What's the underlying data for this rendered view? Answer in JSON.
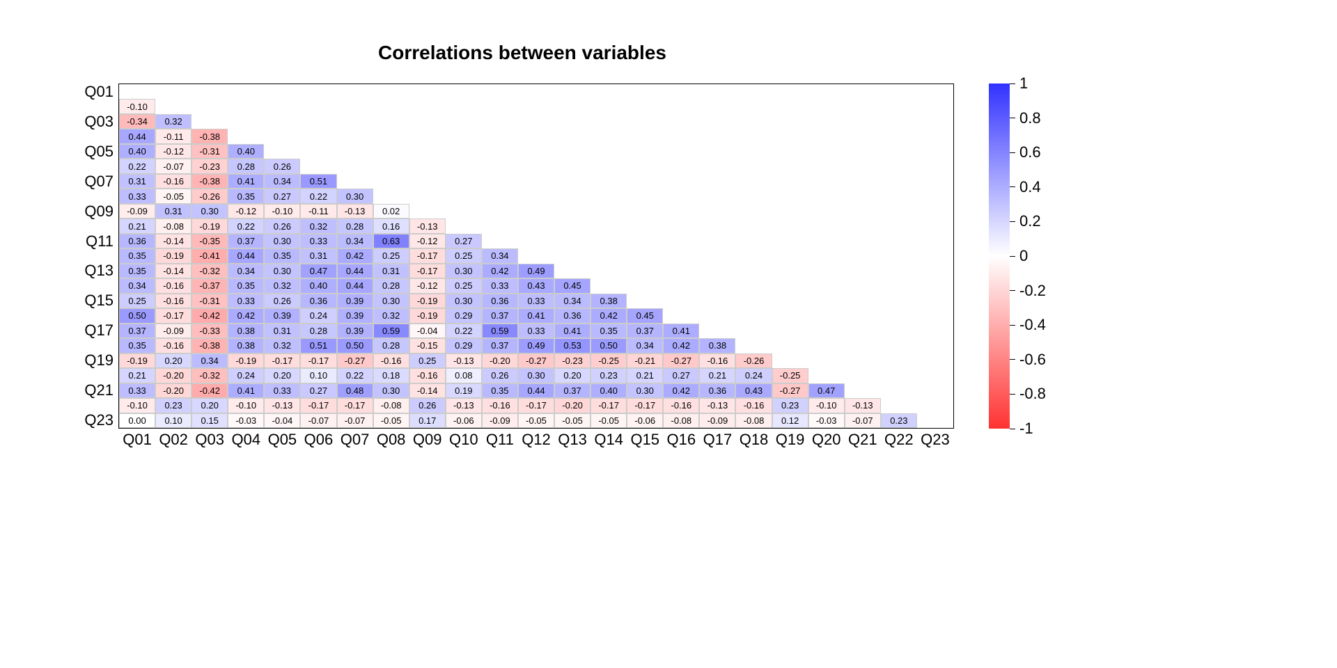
{
  "chart_data": {
    "type": "heatmap",
    "title": "Correlations between variables",
    "variables": [
      "Q01",
      "Q02",
      "Q03",
      "Q04",
      "Q05",
      "Q06",
      "Q07",
      "Q08",
      "Q09",
      "Q10",
      "Q11",
      "Q12",
      "Q13",
      "Q14",
      "Q15",
      "Q16",
      "Q17",
      "Q18",
      "Q19",
      "Q20",
      "Q21",
      "Q22",
      "Q23"
    ],
    "ylabels_shown": [
      "Q01",
      "Q03",
      "Q05",
      "Q07",
      "Q09",
      "Q11",
      "Q13",
      "Q15",
      "Q17",
      "Q19",
      "Q21",
      "Q23"
    ],
    "colorbar": {
      "min": -1,
      "max": 1,
      "ticks": [
        1,
        0.8,
        0.6,
        0.4,
        0.2,
        0,
        -0.2,
        -0.4,
        -0.6,
        -0.8,
        -1
      ],
      "colors": {
        "neg": "#ff0000",
        "zero": "#ffffff",
        "pos": "#0000ff"
      }
    },
    "matrix": [
      [
        null,
        null,
        null,
        null,
        null,
        null,
        null,
        null,
        null,
        null,
        null,
        null,
        null,
        null,
        null,
        null,
        null,
        null,
        null,
        null,
        null,
        null,
        null
      ],
      [
        -0.1,
        null,
        null,
        null,
        null,
        null,
        null,
        null,
        null,
        null,
        null,
        null,
        null,
        null,
        null,
        null,
        null,
        null,
        null,
        null,
        null,
        null,
        null
      ],
      [
        -0.34,
        0.32,
        null,
        null,
        null,
        null,
        null,
        null,
        null,
        null,
        null,
        null,
        null,
        null,
        null,
        null,
        null,
        null,
        null,
        null,
        null,
        null,
        null
      ],
      [
        0.44,
        -0.11,
        -0.38,
        null,
        null,
        null,
        null,
        null,
        null,
        null,
        null,
        null,
        null,
        null,
        null,
        null,
        null,
        null,
        null,
        null,
        null,
        null,
        null
      ],
      [
        0.4,
        -0.12,
        -0.31,
        0.4,
        null,
        null,
        null,
        null,
        null,
        null,
        null,
        null,
        null,
        null,
        null,
        null,
        null,
        null,
        null,
        null,
        null,
        null,
        null
      ],
      [
        0.22,
        -0.07,
        -0.23,
        0.28,
        0.26,
        null,
        null,
        null,
        null,
        null,
        null,
        null,
        null,
        null,
        null,
        null,
        null,
        null,
        null,
        null,
        null,
        null,
        null
      ],
      [
        0.31,
        -0.16,
        -0.38,
        0.41,
        0.34,
        0.51,
        null,
        null,
        null,
        null,
        null,
        null,
        null,
        null,
        null,
        null,
        null,
        null,
        null,
        null,
        null,
        null,
        null
      ],
      [
        0.33,
        -0.05,
        -0.26,
        0.35,
        0.27,
        0.22,
        0.3,
        null,
        null,
        null,
        null,
        null,
        null,
        null,
        null,
        null,
        null,
        null,
        null,
        null,
        null,
        null,
        null
      ],
      [
        -0.09,
        0.31,
        0.3,
        -0.12,
        -0.1,
        -0.11,
        -0.13,
        0.02,
        null,
        null,
        null,
        null,
        null,
        null,
        null,
        null,
        null,
        null,
        null,
        null,
        null,
        null,
        null
      ],
      [
        0.21,
        -0.08,
        -0.19,
        0.22,
        0.26,
        0.32,
        0.28,
        0.16,
        -0.13,
        null,
        null,
        null,
        null,
        null,
        null,
        null,
        null,
        null,
        null,
        null,
        null,
        null,
        null
      ],
      [
        0.36,
        -0.14,
        -0.35,
        0.37,
        0.3,
        0.33,
        0.34,
        0.63,
        -0.12,
        0.27,
        null,
        null,
        null,
        null,
        null,
        null,
        null,
        null,
        null,
        null,
        null,
        null,
        null
      ],
      [
        0.35,
        -0.19,
        -0.41,
        0.44,
        0.35,
        0.31,
        0.42,
        0.25,
        -0.17,
        0.25,
        0.34,
        null,
        null,
        null,
        null,
        null,
        null,
        null,
        null,
        null,
        null,
        null,
        null
      ],
      [
        0.35,
        -0.14,
        -0.32,
        0.34,
        0.3,
        0.47,
        0.44,
        0.31,
        -0.17,
        0.3,
        0.42,
        0.49,
        null,
        null,
        null,
        null,
        null,
        null,
        null,
        null,
        null,
        null,
        null
      ],
      [
        0.34,
        -0.16,
        -0.37,
        0.35,
        0.32,
        0.4,
        0.44,
        0.28,
        -0.12,
        0.25,
        0.33,
        0.43,
        0.45,
        null,
        null,
        null,
        null,
        null,
        null,
        null,
        null,
        null,
        null
      ],
      [
        0.25,
        -0.16,
        -0.31,
        0.33,
        0.26,
        0.36,
        0.39,
        0.3,
        -0.19,
        0.3,
        0.36,
        0.33,
        0.34,
        0.38,
        null,
        null,
        null,
        null,
        null,
        null,
        null,
        null,
        null
      ],
      [
        0.5,
        -0.17,
        -0.42,
        0.42,
        0.39,
        0.24,
        0.39,
        0.32,
        -0.19,
        0.29,
        0.37,
        0.41,
        0.36,
        0.42,
        0.45,
        null,
        null,
        null,
        null,
        null,
        null,
        null,
        null
      ],
      [
        0.37,
        -0.09,
        -0.33,
        0.38,
        0.31,
        0.28,
        0.39,
        0.59,
        -0.04,
        0.22,
        0.59,
        0.33,
        0.41,
        0.35,
        0.37,
        0.41,
        null,
        null,
        null,
        null,
        null,
        null,
        null
      ],
      [
        0.35,
        -0.16,
        -0.38,
        0.38,
        0.32,
        0.51,
        0.5,
        0.28,
        -0.15,
        0.29,
        0.37,
        0.49,
        0.53,
        0.5,
        0.34,
        0.42,
        0.38,
        null,
        null,
        null,
        null,
        null,
        null
      ],
      [
        -0.19,
        0.2,
        0.34,
        -0.19,
        -0.17,
        -0.17,
        -0.27,
        -0.16,
        0.25,
        -0.13,
        -0.2,
        -0.27,
        -0.23,
        -0.25,
        -0.21,
        -0.27,
        -0.16,
        -0.26,
        null,
        null,
        null,
        null,
        null
      ],
      [
        0.21,
        -0.2,
        -0.32,
        0.24,
        0.2,
        0.1,
        0.22,
        0.18,
        -0.16,
        0.08,
        0.26,
        0.3,
        0.2,
        0.23,
        0.21,
        0.27,
        0.21,
        0.24,
        -0.25,
        null,
        null,
        null,
        null
      ],
      [
        0.33,
        -0.2,
        -0.42,
        0.41,
        0.33,
        0.27,
        0.48,
        0.3,
        -0.14,
        0.19,
        0.35,
        0.44,
        0.37,
        0.4,
        0.3,
        0.42,
        0.36,
        0.43,
        -0.27,
        0.47,
        null,
        null,
        null
      ],
      [
        -0.1,
        0.23,
        0.2,
        -0.1,
        -0.13,
        -0.17,
        -0.17,
        -0.08,
        0.26,
        -0.13,
        -0.16,
        -0.17,
        -0.2,
        -0.17,
        -0.17,
        -0.16,
        -0.13,
        -0.16,
        0.23,
        -0.1,
        -0.13,
        null,
        null
      ],
      [
        -0.0,
        0.1,
        0.15,
        -0.03,
        -0.04,
        -0.07,
        -0.07,
        -0.05,
        0.17,
        -0.06,
        -0.09,
        -0.05,
        -0.05,
        -0.05,
        -0.06,
        -0.08,
        -0.09,
        -0.08,
        0.12,
        -0.03,
        -0.07,
        0.23,
        null
      ]
    ]
  }
}
